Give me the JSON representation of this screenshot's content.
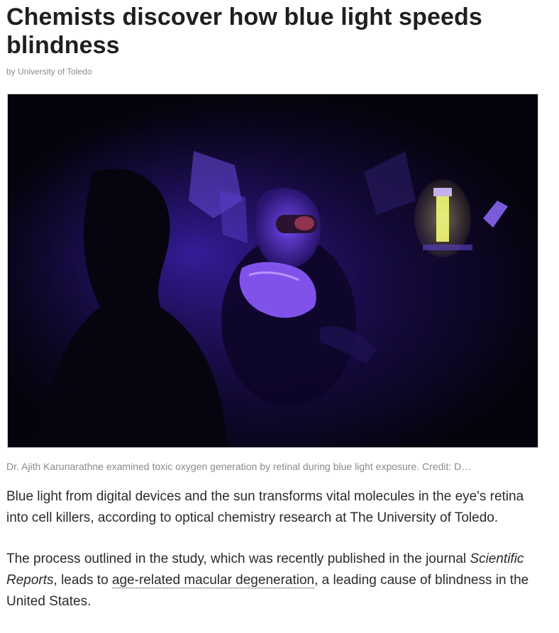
{
  "article": {
    "headline": "Chemists discover how blue light speeds blindness",
    "byline": "by University of Toledo",
    "photo_caption": "Dr. Ajith Karunarathne examined toxic oxygen generation by retinal during blue light exposure. Credit: D…",
    "paragraphs": [
      {
        "text": "Blue light from digital devices and the sun transforms vital molecules in the eye's retina into cell killers, according to optical chemistry research at The University of Toledo."
      },
      {
        "text_before": "The process outlined in the study, which was recently published in the journal ",
        "journal": "Scientific Reports",
        "text_middle": ", leads to ",
        "link_text": "age-related macular degeneration",
        "text_after": ", a leading cause of blindness in the United States."
      }
    ]
  },
  "colors": {
    "headline": "#1f1f1f",
    "body_text": "#2b2b2b",
    "muted_text": "#8a8a8a",
    "photo_glow": "#6a2cff"
  }
}
